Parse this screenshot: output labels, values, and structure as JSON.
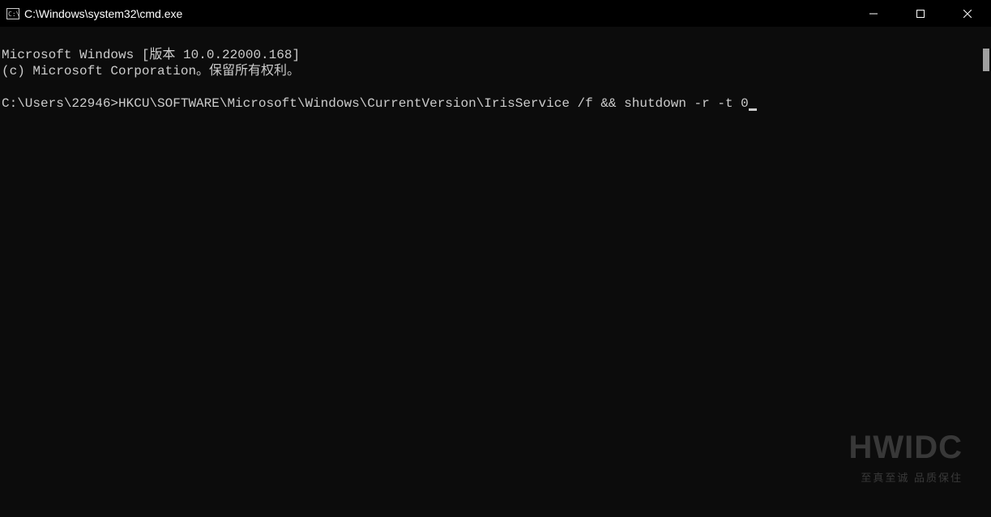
{
  "titlebar": {
    "title": "C:\\Windows\\system32\\cmd.exe"
  },
  "terminal": {
    "line1": "Microsoft Windows [版本 10.0.22000.168]",
    "line2": "(c) Microsoft Corporation。保留所有权利。",
    "line3": "",
    "prompt": "C:\\Users\\22946>",
    "command": "HKCU\\SOFTWARE\\Microsoft\\Windows\\CurrentVersion\\IrisService /f && shutdown -r -t 0"
  },
  "watermark": {
    "main": "HWIDC",
    "sub": "至真至诚  品质保住"
  }
}
